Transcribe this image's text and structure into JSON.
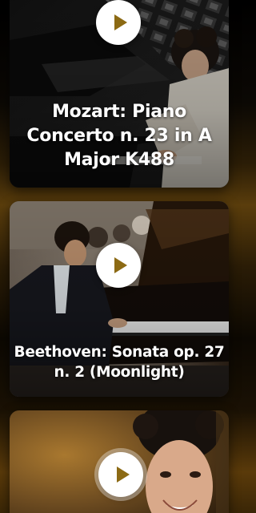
{
  "cards": [
    {
      "title": "Mozart: Piano Concerto n. 23 in A Major K488"
    },
    {
      "title": "Beethoven: Sonata op. 27 n. 2 (Moonlight)"
    },
    {
      "title": ""
    }
  ],
  "colors": {
    "accent": "#8c6a14",
    "play_bg": "#ffffff",
    "background_gold": "#5a3d0c"
  },
  "icons": {
    "play": "play-icon"
  }
}
